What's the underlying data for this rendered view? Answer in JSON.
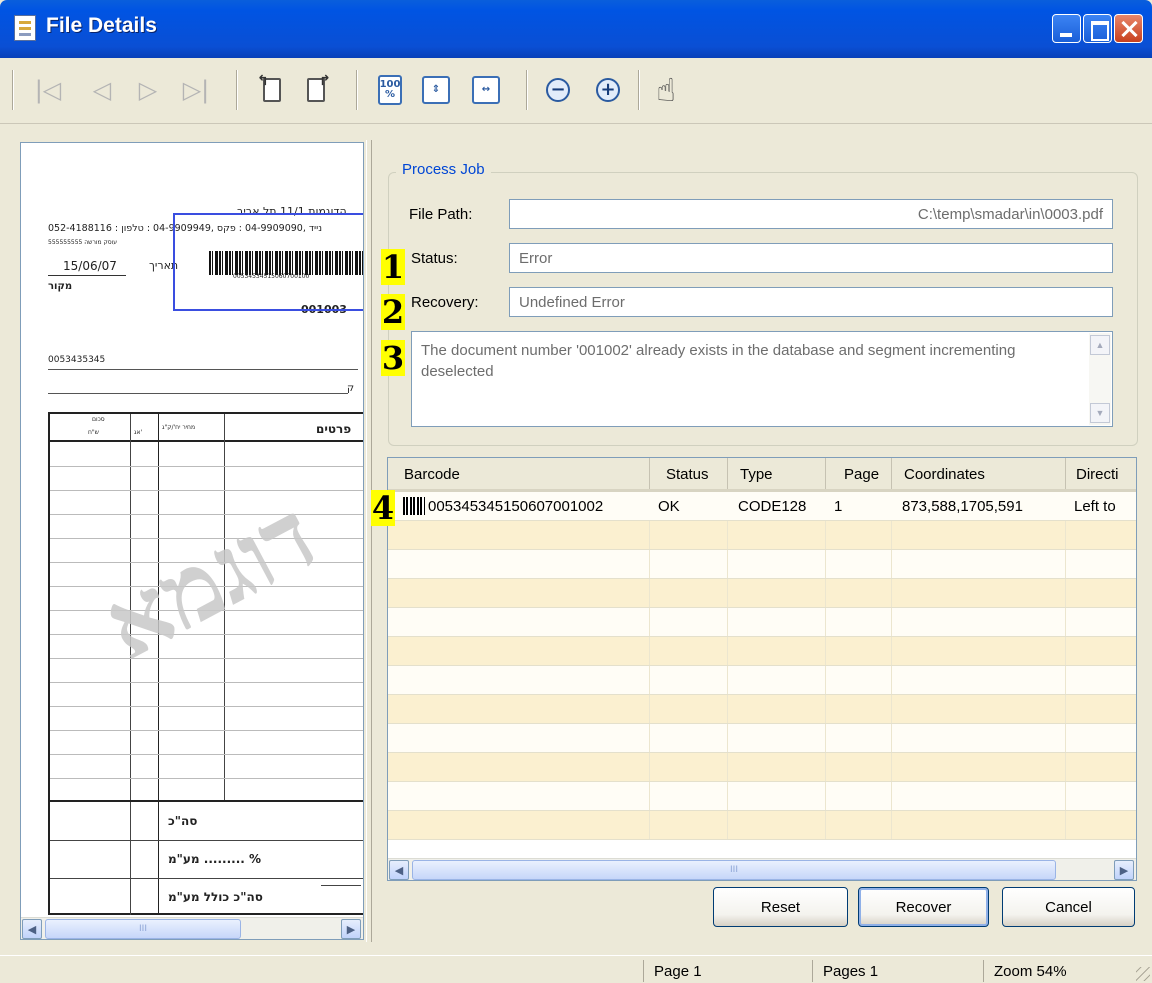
{
  "window": {
    "title": "File Details"
  },
  "toolbar": {
    "buttons": [
      {
        "name": "first-page",
        "icon": "first-page-icon"
      },
      {
        "name": "previous-page",
        "icon": "previous-page-icon"
      },
      {
        "name": "next-page",
        "icon": "next-page-icon"
      },
      {
        "name": "last-page",
        "icon": "last-page-icon"
      },
      {
        "name": "rotate-left",
        "icon": "rotate-left-icon"
      },
      {
        "name": "rotate-right",
        "icon": "rotate-right-icon"
      },
      {
        "name": "actual-size",
        "icon": "zoom-100-icon",
        "label": "100 %"
      },
      {
        "name": "fit-page",
        "icon": "fit-page-icon"
      },
      {
        "name": "fit-width",
        "icon": "fit-width-icon"
      },
      {
        "name": "zoom-out",
        "icon": "zoom-out-icon"
      },
      {
        "name": "zoom-in",
        "icon": "zoom-in-icon"
      },
      {
        "name": "pan",
        "icon": "hand-icon"
      }
    ]
  },
  "preview": {
    "address": "הדוגמות 11/1 תל אביב",
    "phone": "052-4188116 : נייד ,04-9909090 : פקס ,04-9909949 : טלפון",
    "license": "עוסק מורשה 555555555",
    "date": "15/06/07",
    "date_label": "תאריך",
    "source_label": "מקור",
    "barcode_text": "00534534515060700100",
    "doc_number": "001003",
    "customer_code": "0053435345",
    "col_items": "פרטים",
    "col_price": "מחיר יח'/ק\"ג",
    "col_amount": "סכום",
    "col_ag": "אג'",
    "col_shekel": "ש\"ח",
    "total": "סה\"כ",
    "vat": "מע\"מ ......... %",
    "total_incl": "סה\"כ כולל מע\"מ",
    "watermark": "דוגמא"
  },
  "process_job": {
    "title": "Process Job",
    "file_path_label": "File Path:",
    "file_path": "C:\\temp\\smadar\\in\\0003.pdf",
    "status_label": "Status:",
    "status": "Error",
    "recovery_label": "Recovery:",
    "recovery": "Undefined Error",
    "message": "The document number '001002' already exists in the database and segment incrementing deselected"
  },
  "markers": [
    "1",
    "2",
    "3",
    "4"
  ],
  "barcodes": {
    "columns": [
      "Barcode",
      "Status",
      "Type",
      "Page",
      "Coordinates",
      "Directi"
    ],
    "rows": [
      {
        "barcode": "005345345150607001002",
        "status": "OK",
        "type": "CODE128",
        "page": "1",
        "coordinates": "873,588,1705,591",
        "direction": "Left to"
      }
    ]
  },
  "buttons": {
    "reset": "Reset",
    "recover": "Recover",
    "cancel": "Cancel"
  },
  "statusbar": {
    "page": "Page 1",
    "pages": "Pages 1",
    "zoom": "Zoom 54%"
  },
  "scroll_glyph": "III"
}
